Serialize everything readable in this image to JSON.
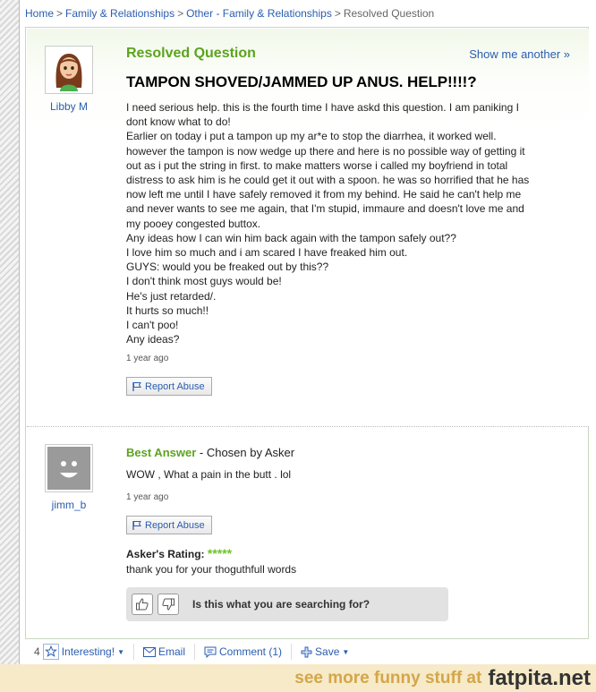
{
  "breadcrumb": {
    "items": [
      "Home",
      "Family & Relationships",
      "Other - Family & Relationships"
    ],
    "separator": ">",
    "current": "Resolved Question"
  },
  "question": {
    "status_label": "Resolved Question",
    "show_another_label": "Show me another »",
    "asker_name": "Libby M",
    "title": "TAMPON SHOVED/JAMMED UP ANUS. HELP!!!!?",
    "body_lines": [
      "I need serious help. this is the fourth time I have askd this question. I am paniking I",
      "dont know what to do!",
      "Earlier on today i put a tampon up my ar*e to stop the diarrhea, it worked well.",
      "however the tampon is now wedge up there and here is no possible way of getting it",
      "out as i put the string in first. to make matters worse i called my boyfriend in total",
      "distress to ask him is he could get it out with a spoon. he was so horrified that he has",
      "now left me until I have safely removed it from my behind. He said he can't help me",
      "and never wants to see me again, that I'm stupid, immaure and doesn't love me and",
      "my pooey congested buttox.",
      "Any ideas how I can win him back again with the tampon safely out??",
      "I love him so much and i am scared I have freaked him out.",
      "GUYS: would you be freaked out by this??",
      "I don't think most guys would be!",
      "He's just retarded/.",
      "It hurts so much!!",
      "I can't poo!",
      "Any ideas?"
    ],
    "timestamp": "1 year ago",
    "report_label": "Report Abuse"
  },
  "answer": {
    "label": "Best Answer",
    "chosen_by": " - Chosen by Asker",
    "answerer_name": "jimm_b",
    "text": "WOW , What a pain in the butt . lol",
    "timestamp": "1 year ago",
    "report_label": "Report Abuse",
    "rating_label": "Asker's Rating:",
    "rating_stars_text": "*****",
    "rating": 5,
    "rating_comment": "thank you for your thoguthfull words",
    "search_prompt": "Is this what you are searching for?"
  },
  "footer": {
    "interesting_count": "4",
    "interesting_label": "Interesting!",
    "email_label": "Email",
    "comment_label": "Comment (1)",
    "save_label": "Save"
  },
  "watermark": {
    "prefix": "see more funny stuff at",
    "site": "fatpita.net"
  },
  "colors": {
    "link": "#2a5db0",
    "accent_green": "#5ca31f",
    "star_green": "#6cc424",
    "watermark_bg": "#f6eac8"
  }
}
